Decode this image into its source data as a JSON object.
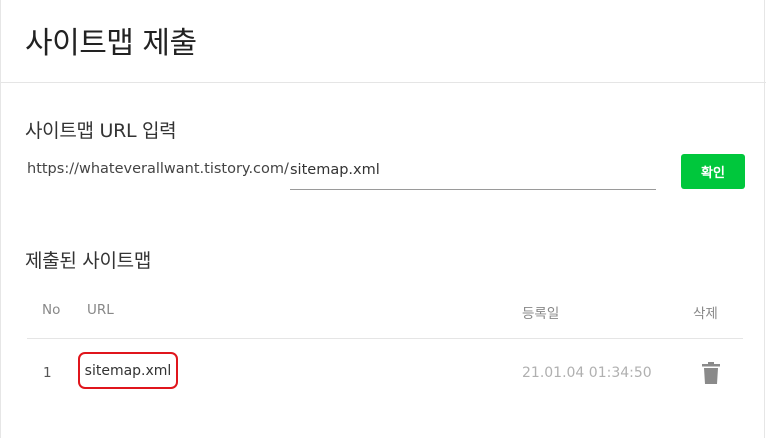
{
  "page": {
    "title": "사이트맵 제출"
  },
  "url_section": {
    "title": "사이트맵 URL 입력",
    "prefix": "https://whateverallwant.tistory.com/",
    "input_value": "sitemap.xml",
    "confirm_label": "확인"
  },
  "list_section": {
    "title": "제출된 사이트맵",
    "columns": {
      "no": "No",
      "url": "URL",
      "date": "등록일",
      "delete": "삭제"
    },
    "rows": [
      {
        "no": "1",
        "url": "sitemap.xml",
        "date": "21.01.04 01:34:50",
        "delete_icon": "trash-icon"
      }
    ]
  },
  "colors": {
    "accent": "#00c73c",
    "highlight": "#e0151c"
  }
}
